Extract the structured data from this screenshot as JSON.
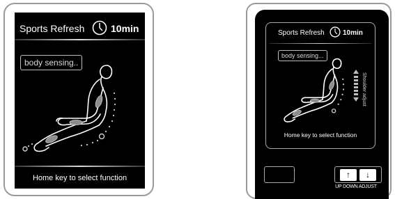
{
  "left_screen": {
    "program": "Sports Refresh",
    "time": "10min",
    "status": "body sensing..",
    "footer": "Home key to select function"
  },
  "right_screen": {
    "program": "Sports Refresh",
    "time": "10min",
    "status": "body sensing...",
    "shoulder_label": "Shoulder adjust",
    "footer": "Home key to select function",
    "up_key_icon": "↑",
    "down_key_icon": "↓",
    "adjust_label": "UP DOWN ADJUST"
  },
  "icons": [
    "clock-icon",
    "seated-body-figure-icon",
    "arrow-up-icon",
    "arrow-down-icon"
  ]
}
